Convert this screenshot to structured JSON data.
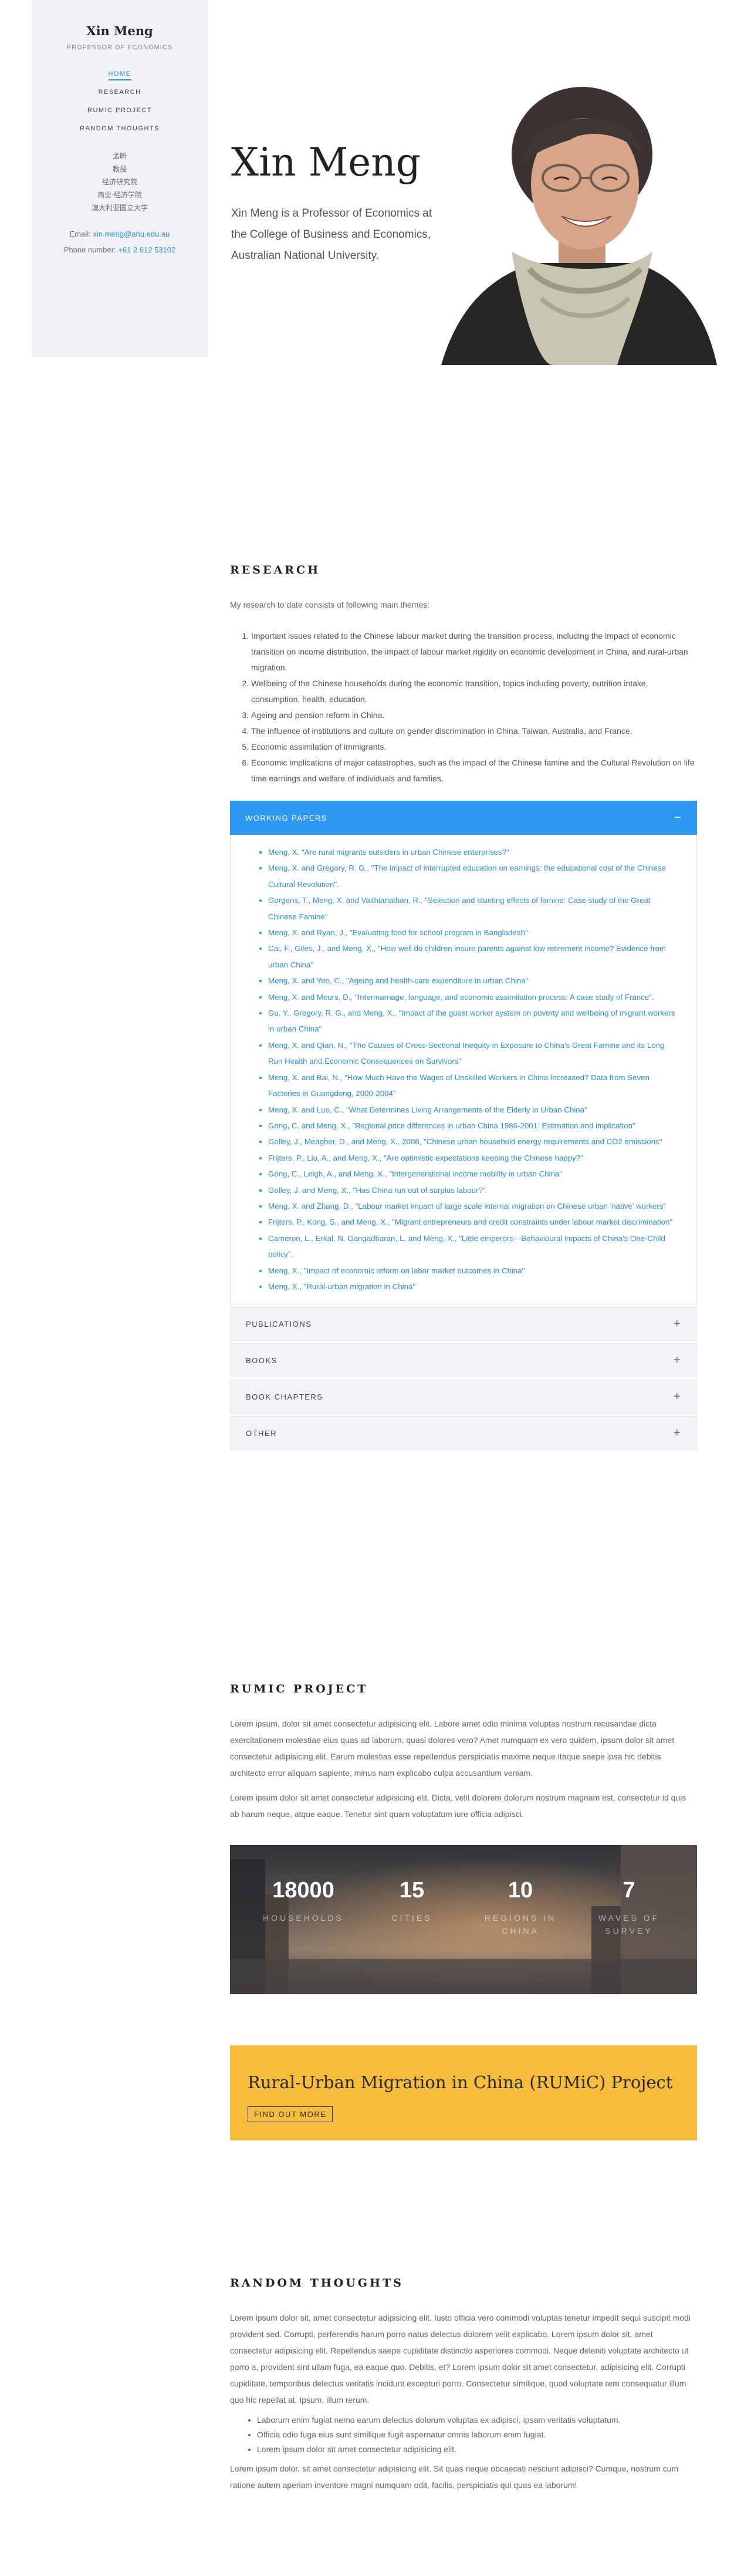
{
  "sidebar": {
    "name": "Xin Meng",
    "role": "PROFESSOR OF ECONOMICS",
    "nav": [
      "HOME",
      "RESEARCH",
      "RUMIC PROJECT",
      "RANDOM THOUGHTS"
    ],
    "chinese": [
      "孟昕",
      "教授",
      "经济研究院",
      "商业·经济学院",
      "澳大利亚国立大学"
    ],
    "email_label": "Email:",
    "email": "xin.meng@anu.edu.au",
    "phone_label": "Phone number:",
    "phone": "+61 2 612 53102"
  },
  "hero": {
    "title": "Xin Meng",
    "bio": "Xin Meng is a Professor of Economics at the College of Business and Economics, Australian National University."
  },
  "research": {
    "title": "RESEARCH",
    "intro": "My research to date consists of following main themes:",
    "themes": [
      "Important issues related to the Chinese labour market during the transition process, including the impact of economic transition on income distribution, the impact of labour market rigidity on economic development in China, and rural-urban migration.",
      "Wellbeing of the Chinese households during the economic transition, topics including poverty, nutrition intake, consumption, health, education.",
      "Ageing and pension reform in China.",
      "The influence of institutions and culture on gender discrimination in China, Taiwan, Australia, and France.",
      "Economic assimilation of immigrants.",
      "Economic implications of major catastrophes, such as the impact of the Chinese famine and the Cultural Revolution on life time earnings and welfare of individuals and families."
    ],
    "open_tab": {
      "label": "WORKING PAPERS",
      "sign": "−",
      "papers": [
        "Meng, X. \"Are rural migrants outsiders in urban Chinese enterprises?\"",
        "Meng, X. and Gregory, R. G., \"The impact of interrupted education on earnings: the educational cost of the Chinese Cultural Revolution\".",
        "Gorgens, T., Meng, X. and Vaithianathan, R., \"Selection and stunting effects of famine: Case study of the Great Chinese Famine\"",
        "Meng, X. and Ryan, J., \"Evaluating food for school program in Bangladesh\"",
        "Cai, F., Giles, J., and Meng, X., \"How well do children insure parents against low retirement income? Evidence from urban China\"",
        "Meng, X. and Yeo, C., \"Ageing and health-care expenditure in urban China\"",
        "Meng, X. and Meurs, D., \"Intermarriage, language, and economic assimilation process: A case study of France\".",
        "Gu, Y., Gregory, R. G., and Meng, X., \"Impact of the guest worker system on poverty and wellbeing of migrant workers in urban China\"",
        "Meng, X. and Qian, N., \"The Causes of Cross-Sectional Inequity in Exposure to China's Great Famine and its Long Run Health and Economic Consequences on Survivors\"",
        "Meng, X. and Bai, N., \"How Much Have the Wages of Unskilled Workers in China Increased? Data from Seven Factories in Guangdong, 2000-2004\"",
        "Meng, X. and Luo, C., \"What Determines Living Arrangements of the Elderly in Urban China\"",
        "Gong, C. and Meng, X., \"Regional price differences in urban China 1986-2001: Estimation and implication\"",
        "Golley, J., Meagher, D., and Meng, X., 2008, \"Chinese urban household energy requirements and CO2 emissions\"",
        "Frijters, P., Liu, A., and Meng, X., \"Are optimistic expectations keeping the Chinese happy?\"",
        "Gong, C., Leigh, A., and Meng, X., \"Intergenerational income mobility in urban China\"",
        "Golley, J. and Meng, X., \"Has China run out of surplus labour?\"",
        "Meng, X. and Zhang, D., \"Labour market impact of large scale internal migration on Chinese urban 'native' workers\"",
        "Frijters, P., Kong, S., and Meng, X., \"Migrant entrepreneurs and credit constraints under labour market discrimination\"",
        "Cameron, L., Erkal, N. Gangadharan, L. and Meng, X., \"Little emperors—Behavioural impacts of China's One-Child policy\".",
        "Meng, X., \"Impact of economic reform on labor market outcomes in China\"",
        "Meng, X., \"Rural-urban migration in China\""
      ]
    },
    "closed_tabs": [
      {
        "label": "PUBLICATIONS",
        "sign": "+"
      },
      {
        "label": "BOOKS",
        "sign": "+"
      },
      {
        "label": "BOOK CHAPTERS",
        "sign": "+"
      },
      {
        "label": "OTHER",
        "sign": "+"
      }
    ]
  },
  "rumic": {
    "title": "RUMIC PROJECT",
    "para1": "Lorem ipsum, dolor sit amet consectetur adipisicing elit. Labore amet odio minima voluptas nostrum recusandae dicta exercitationem molestiae eius quas ad laborum, quasi dolores vero? Amet numquam ex vero quidem, ipsum dolor sit amet consectetur adipisicing elit. Earum molestias esse repellendus perspiciatis maxime neque itaque saepe ipsa hic debitis architecto error aliquam sapiente, minus nam explicabo culpa accusantium veniam.",
    "para2": "Lorem ipsum dolor sit amet consectetur adipisicing elit. Dicta, velit dolorem dolorum nostrum magnam est, consectetur id quis ab harum neque, atque eaque. Tenetur sint quam voluptatum iure officia adipisci.",
    "stats": [
      {
        "num": "18000",
        "label": "HOUSEHOLDS"
      },
      {
        "num": "15",
        "label": "CITIES"
      },
      {
        "num": "10",
        "label": "REGIONS IN CHINA"
      },
      {
        "num": "7",
        "label": "WAVES OF SURVEY"
      }
    ],
    "cta_title": "Rural-Urban Migration in China (RUMiC) Project",
    "cta_button": "FIND OUT MORE"
  },
  "thoughts": {
    "title": "RANDOM THOUGHTS",
    "para1": "Lorem ipsum dolor sit, amet consectetur adipisicing elit. Iusto officia vero commodi voluptas tenetur impedit sequi suscipit modi provident sed. Corrupti, perferendis harum porro natus delectus dolorem velit explicabo. Lorem ipsum dolor sit, amet consectetur adipisicing elit. Repellendus saepe cupiditate distinctio asperiores commodi. Neque deleniti voluptate architecto ut porro a, provident sint ullam fuga, ea eaque quo. Debitis, et? Lorem ipsum dolor sit amet consectetur, adipisicing elit. Corrupti cupiditate, temporibus delectus veritatis incidunt excepturi porro. Consectetur similique, quod voluptate rem consequatur illum quo hic repellat at. Ipsum, illum rerum.",
    "bullets": [
      "Laborum enim fugiat nemo earum delectus dolorum voluptas ex adipisci, ipsam veritatis voluptatum.",
      "Officia odio fuga eius sunt similique fugit aspernatur omnis laborum enim fugiat.",
      "Lorem ipsum dolor sit amet consectetur adipisicing elit."
    ],
    "para2": "Lorem ipsum dolor, sit amet consectetur adipisicing elit. Sit quas neque obcaecati nesciunt adipisci? Cumque, nostrum cum ratione autem aperiam inventore magni numquam odit, facilis, perspiciatis qui quas ea laborum!"
  }
}
